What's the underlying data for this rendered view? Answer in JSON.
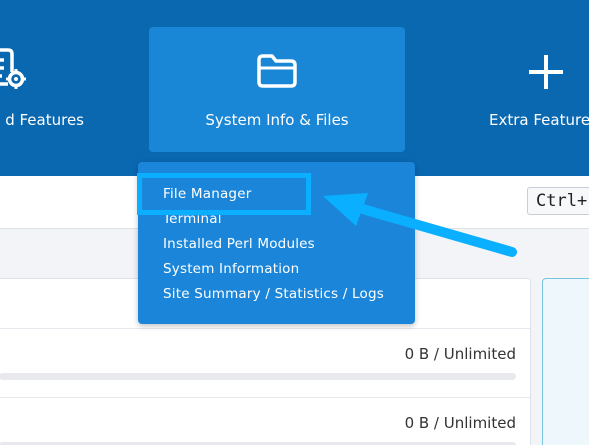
{
  "nav": {
    "left_label": "d Features",
    "active_label": "System Info & Files",
    "right_label": "Extra Feature",
    "icons": {
      "left": "list-gear-icon",
      "active": "folder-icon",
      "right": "plus-icon"
    }
  },
  "shortcut": {
    "hint": "Ctrl+"
  },
  "dropdown": {
    "items": [
      "File Manager",
      "Terminal",
      "Installed Perl Modules",
      "System Information",
      "Site Summary / Statistics / Logs"
    ]
  },
  "panel": {
    "rows": [
      {
        "value": "0 B / Unlimited",
        "fraction": 0
      },
      {
        "value": "0 B / Unlimited",
        "fraction": 0
      }
    ]
  },
  "colors": {
    "nav_bg": "#0a68b1",
    "nav_active": "#1a86d6",
    "dropdown_bg": "#1b86d9",
    "annotation": "#0aafff"
  }
}
